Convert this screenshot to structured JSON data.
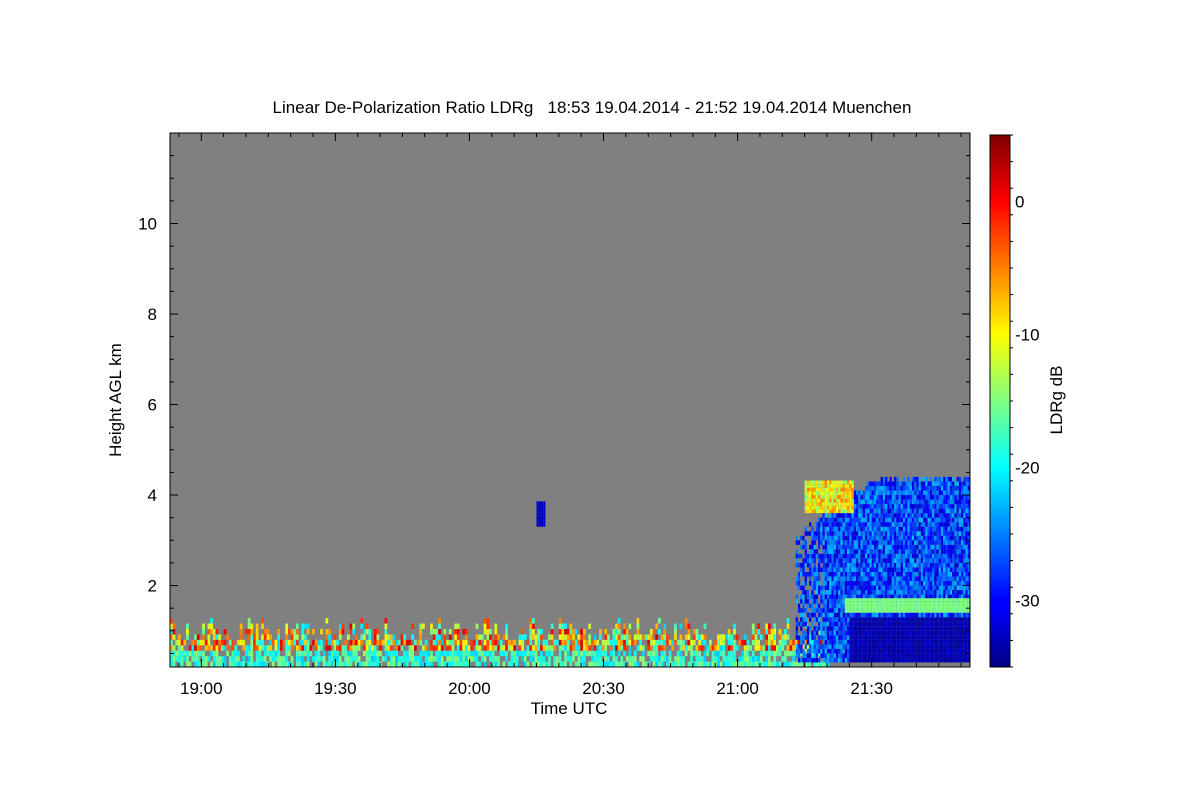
{
  "chart_data": {
    "type": "heatmap",
    "title": "Linear De-Polarization Ratio LDRg   18:53 19.04.2014 - 21:52 19.04.2014 Muenchen",
    "xlabel": "Time UTC",
    "ylabel": "Height AGL km",
    "colorbar_label": "LDRg dB",
    "x_range": [
      "18:53",
      "21:52"
    ],
    "x_ticks": [
      "19:00",
      "19:30",
      "20:00",
      "20:30",
      "21:00",
      "21:30"
    ],
    "y_range": [
      0.2,
      12
    ],
    "y_ticks": [
      2,
      4,
      6,
      8,
      10
    ],
    "colorbar_range": [
      -35,
      5
    ],
    "colorbar_ticks": [
      0,
      -10,
      -20,
      -30
    ],
    "background_color": "#808080",
    "colormap": "jet",
    "features": [
      {
        "description": "noisy near-surface layer",
        "time_start": "18:53",
        "time_end": "21:20",
        "height_bottom": 0.2,
        "height_top": 1.2,
        "ldr_db_range": [
          -22,
          2
        ]
      },
      {
        "description": "small isolated echo",
        "time_start": "20:15",
        "time_end": "20:17",
        "height_bottom": 3.3,
        "height_top": 3.8,
        "ldr_db": -32
      },
      {
        "description": "cloud system",
        "time_start": "21:13",
        "time_end": "21:52",
        "height_bottom": 0.3,
        "height_top": 4.4,
        "ldr_db_range": [
          -32,
          -20
        ]
      },
      {
        "description": "bright band / melting layer",
        "time_start": "21:24",
        "time_end": "21:52",
        "height_bottom": 1.4,
        "height_top": 1.7,
        "ldr_db": -15
      },
      {
        "description": "strong depolarization spots near cloud top",
        "time_start": "21:15",
        "time_end": "21:26",
        "height_bottom": 3.6,
        "height_top": 4.3,
        "ldr_db_range": [
          -15,
          -5
        ]
      }
    ]
  }
}
